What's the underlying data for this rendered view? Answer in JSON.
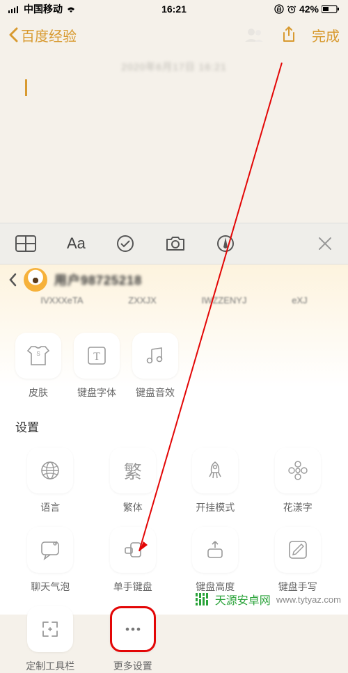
{
  "status": {
    "carrier": "中国移动",
    "time": "16:21",
    "battery": "42%"
  },
  "nav": {
    "back_label": "百度经验",
    "done_label": "完成"
  },
  "note": {
    "date_line": "2020年6月17日  16:21"
  },
  "panel": {
    "username": "用户98725218"
  },
  "row1": {
    "skin": "皮肤",
    "font": "键盘字体",
    "sound": "键盘音效"
  },
  "settings": {
    "section": "设置",
    "language": "语言",
    "traditional": "繁体",
    "cheat": "开挂模式",
    "flower": "花漾字",
    "bubble": "聊天气泡",
    "onehand": "单手键盘",
    "height": "键盘高度",
    "handwrite": "键盘手写",
    "customize": "定制工具栏",
    "more": "更多设置"
  },
  "watermark": {
    "name": "天源安卓网",
    "url": "www.tytyaz.com"
  }
}
